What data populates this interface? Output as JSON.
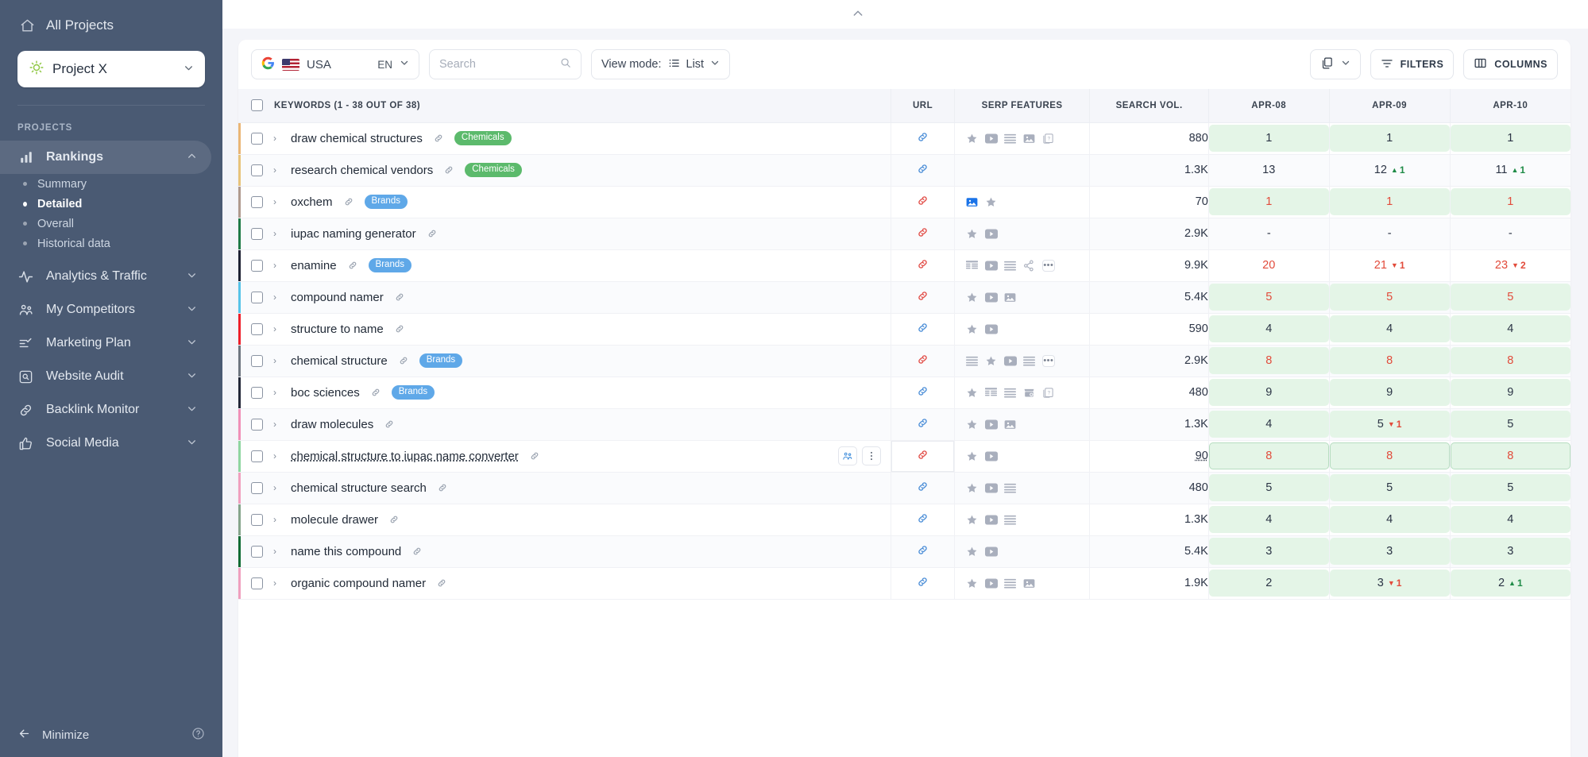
{
  "sidebar": {
    "all_projects_label": "All Projects",
    "project_name": "Project X",
    "section_label": "PROJECTS",
    "nav": [
      {
        "label": "Rankings",
        "icon": "bar-chart-icon",
        "expanded": true,
        "active": true
      },
      {
        "label": "Analytics & Traffic",
        "icon": "pulse-icon",
        "expanded": false,
        "active": false
      },
      {
        "label": "My Competitors",
        "icon": "people-icon",
        "expanded": false,
        "active": false
      },
      {
        "label": "Marketing Plan",
        "icon": "checklist-icon",
        "expanded": false,
        "active": false
      },
      {
        "label": "Website Audit",
        "icon": "magnifier-box-icon",
        "expanded": false,
        "active": false
      },
      {
        "label": "Backlink Monitor",
        "icon": "link-icon",
        "expanded": false,
        "active": false
      },
      {
        "label": "Social Media",
        "icon": "thumbs-up-icon",
        "expanded": false,
        "active": false
      }
    ],
    "rankings_sub": [
      {
        "label": "Summary",
        "current": false
      },
      {
        "label": "Detailed",
        "current": true
      },
      {
        "label": "Overall",
        "current": false
      },
      {
        "label": "Historical data",
        "current": false
      }
    ],
    "minimize_label": "Minimize",
    "help_icon": "question-circle-icon"
  },
  "toolbar": {
    "engine_icon": "google-icon",
    "country": "USA",
    "language": "EN",
    "search_placeholder": "Search",
    "search_value": "",
    "view_mode_label": "View mode:",
    "view_mode_value": "List",
    "copy_icon": "copy-icon",
    "filters_label": "FILTERS",
    "columns_label": "COLUMNS"
  },
  "table": {
    "headers": {
      "keywords": "KEYWORDS (1 - 38 OUT OF 38)",
      "url": "URL",
      "serp": "SERP FEATURES",
      "volume": "SEARCH VOL.",
      "date1": "APR-08",
      "date2": "APR-09",
      "date3": "APR-10"
    },
    "rows": [
      {
        "keyword": "draw chemical structures",
        "tag": "Chemicals",
        "tag_type": "chemicals",
        "rowcolor": "#eab676",
        "link_color": "#4f90d8",
        "serp": [
          "star",
          "video",
          "list",
          "image",
          "cards"
        ],
        "volume": "880",
        "ranks": [
          {
            "value": "1",
            "bg": "top",
            "color": "dark",
            "delta": null
          },
          {
            "value": "1",
            "bg": "top",
            "color": "dark",
            "delta": null
          },
          {
            "value": "1",
            "bg": "top",
            "color": "dark",
            "delta": null
          }
        ]
      },
      {
        "keyword": "research chemical vendors",
        "tag": "Chemicals",
        "tag_type": "chemicals",
        "rowcolor": "#e8c37a",
        "link_color": "#4f90d8",
        "serp": [],
        "volume": "1.3K",
        "ranks": [
          {
            "value": "13",
            "bg": "plain",
            "color": "dark",
            "delta": null
          },
          {
            "value": "12",
            "bg": "plain",
            "color": "dark",
            "delta": {
              "dir": "up",
              "amount": "1"
            }
          },
          {
            "value": "11",
            "bg": "plain",
            "color": "dark",
            "delta": {
              "dir": "up",
              "amount": "1"
            }
          }
        ]
      },
      {
        "keyword": "oxchem",
        "tag": "Brands",
        "tag_type": "brands",
        "rowcolor": "#b09a8e",
        "link_color": "#e2504a",
        "serp": [
          "image-blue",
          "star"
        ],
        "volume": "70",
        "ranks": [
          {
            "value": "1",
            "bg": "top",
            "color": "red",
            "delta": null
          },
          {
            "value": "1",
            "bg": "top",
            "color": "red",
            "delta": null
          },
          {
            "value": "1",
            "bg": "top",
            "color": "red",
            "delta": null
          }
        ]
      },
      {
        "keyword": "iupac naming generator",
        "tag": null,
        "tag_type": null,
        "rowcolor": "#1f7a46",
        "link_color": "#e2504a",
        "serp": [
          "star",
          "video"
        ],
        "volume": "2.9K",
        "ranks": [
          {
            "value": "-",
            "bg": "plain",
            "color": "dark",
            "delta": null
          },
          {
            "value": "-",
            "bg": "plain",
            "color": "dark",
            "delta": null
          },
          {
            "value": "-",
            "bg": "plain",
            "color": "dark",
            "delta": null
          }
        ]
      },
      {
        "keyword": "enamine",
        "tag": "Brands",
        "tag_type": "brands",
        "rowcolor": "#1e2233",
        "link_color": "#e2504a",
        "serp": [
          "table",
          "video",
          "list",
          "graph",
          "more"
        ],
        "volume": "9.9K",
        "ranks": [
          {
            "value": "20",
            "bg": "plain",
            "color": "red",
            "delta": null
          },
          {
            "value": "21",
            "bg": "plain",
            "color": "red",
            "delta": {
              "dir": "down",
              "amount": "1"
            }
          },
          {
            "value": "23",
            "bg": "plain",
            "color": "red",
            "delta": {
              "dir": "down",
              "amount": "2"
            }
          }
        ]
      },
      {
        "keyword": "compound namer",
        "tag": null,
        "tag_type": null,
        "rowcolor": "#57c3e8",
        "link_color": "#e2504a",
        "serp": [
          "star",
          "video",
          "image"
        ],
        "volume": "5.4K",
        "ranks": [
          {
            "value": "5",
            "bg": "top",
            "color": "red",
            "delta": null
          },
          {
            "value": "5",
            "bg": "top",
            "color": "red",
            "delta": null
          },
          {
            "value": "5",
            "bg": "top",
            "color": "red",
            "delta": null
          }
        ]
      },
      {
        "keyword": "structure to name",
        "tag": null,
        "tag_type": null,
        "rowcolor": "#ee1f2a",
        "link_color": "#4f90d8",
        "serp": [
          "star",
          "video"
        ],
        "volume": "590",
        "ranks": [
          {
            "value": "4",
            "bg": "top",
            "color": "dark",
            "delta": null
          },
          {
            "value": "4",
            "bg": "top",
            "color": "dark",
            "delta": null
          },
          {
            "value": "4",
            "bg": "top",
            "color": "dark",
            "delta": null
          }
        ]
      },
      {
        "keyword": "chemical structure",
        "tag": "Brands",
        "tag_type": "brands",
        "rowcolor": "#6f7680",
        "link_color": "#e2504a",
        "serp": [
          "list",
          "star",
          "video",
          "list",
          "more"
        ],
        "volume": "2.9K",
        "ranks": [
          {
            "value": "8",
            "bg": "top",
            "color": "red",
            "delta": null
          },
          {
            "value": "8",
            "bg": "top",
            "color": "red",
            "delta": null
          },
          {
            "value": "8",
            "bg": "top",
            "color": "red",
            "delta": null
          }
        ]
      },
      {
        "keyword": "boc sciences",
        "tag": "Brands",
        "tag_type": "brands",
        "rowcolor": "#232838",
        "link_color": "#4f90d8",
        "serp": [
          "star",
          "table",
          "list",
          "shop",
          "cards"
        ],
        "volume": "480",
        "ranks": [
          {
            "value": "9",
            "bg": "top",
            "color": "dark",
            "delta": null
          },
          {
            "value": "9",
            "bg": "top",
            "color": "dark",
            "delta": null
          },
          {
            "value": "9",
            "bg": "top",
            "color": "dark",
            "delta": null
          }
        ]
      },
      {
        "keyword": "draw molecules",
        "tag": null,
        "tag_type": null,
        "rowcolor": "#f090b8",
        "link_color": "#4f90d8",
        "serp": [
          "star",
          "video",
          "image"
        ],
        "volume": "1.3K",
        "ranks": [
          {
            "value": "4",
            "bg": "top",
            "color": "dark",
            "delta": null
          },
          {
            "value": "5",
            "bg": "top",
            "color": "dark",
            "delta": {
              "dir": "down",
              "amount": "1"
            }
          },
          {
            "value": "5",
            "bg": "top",
            "color": "dark",
            "delta": null
          }
        ]
      },
      {
        "keyword": "chemical structure to iupac name converter",
        "tag": null,
        "tag_type": null,
        "rowcolor": "#8fd6a0",
        "link_color": "#e2504a",
        "hovered": true,
        "serp": [
          "star",
          "video"
        ],
        "volume": "90",
        "ranks": [
          {
            "value": "8",
            "bg": "top outlined",
            "color": "red",
            "delta": null
          },
          {
            "value": "8",
            "bg": "top outlined",
            "color": "red",
            "delta": null
          },
          {
            "value": "8",
            "bg": "top outlined",
            "color": "red",
            "delta": null
          }
        ]
      },
      {
        "keyword": "chemical structure search",
        "tag": null,
        "tag_type": null,
        "rowcolor": "#f0a0bf",
        "link_color": "#4f90d8",
        "serp": [
          "star",
          "video",
          "list"
        ],
        "volume": "480",
        "ranks": [
          {
            "value": "5",
            "bg": "top",
            "color": "dark",
            "delta": null
          },
          {
            "value": "5",
            "bg": "top",
            "color": "dark",
            "delta": null
          },
          {
            "value": "5",
            "bg": "top",
            "color": "dark",
            "delta": null
          }
        ]
      },
      {
        "keyword": "molecule drawer",
        "tag": null,
        "tag_type": null,
        "rowcolor": "#86a58c",
        "link_color": "#4f90d8",
        "serp": [
          "star",
          "video",
          "list"
        ],
        "volume": "1.3K",
        "ranks": [
          {
            "value": "4",
            "bg": "top",
            "color": "dark",
            "delta": null
          },
          {
            "value": "4",
            "bg": "top",
            "color": "dark",
            "delta": null
          },
          {
            "value": "4",
            "bg": "top",
            "color": "dark",
            "delta": null
          }
        ]
      },
      {
        "keyword": "name this compound",
        "tag": null,
        "tag_type": null,
        "rowcolor": "#0f6b33",
        "link_color": "#4f90d8",
        "serp": [
          "star",
          "video"
        ],
        "volume": "5.4K",
        "ranks": [
          {
            "value": "3",
            "bg": "top",
            "color": "dark",
            "delta": null
          },
          {
            "value": "3",
            "bg": "top",
            "color": "dark",
            "delta": null
          },
          {
            "value": "3",
            "bg": "top",
            "color": "dark",
            "delta": null
          }
        ]
      },
      {
        "keyword": "organic compound namer",
        "tag": null,
        "tag_type": null,
        "rowcolor": "#f0a0bf",
        "link_color": "#4f90d8",
        "serp": [
          "star",
          "video",
          "list",
          "image"
        ],
        "volume": "1.9K",
        "ranks": [
          {
            "value": "2",
            "bg": "top",
            "color": "dark",
            "delta": null
          },
          {
            "value": "3",
            "bg": "top",
            "color": "dark",
            "delta": {
              "dir": "down",
              "amount": "1"
            }
          },
          {
            "value": "2",
            "bg": "top",
            "color": "dark",
            "delta": {
              "dir": "up",
              "amount": "1"
            }
          }
        ]
      }
    ]
  }
}
